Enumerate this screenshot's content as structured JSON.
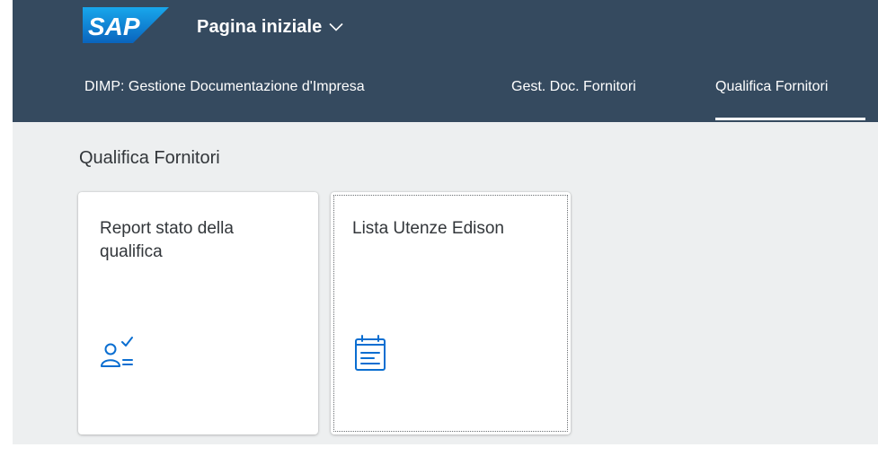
{
  "shell": {
    "logo_text": "SAP",
    "title": "Pagina iniziale",
    "title_menu_icon": "chevron-down-icon"
  },
  "tabs": [
    {
      "label": "DIMP: Gestione Documentazione d'Impresa",
      "active": false
    },
    {
      "label": "Gest. Doc. Fornitori",
      "active": false
    },
    {
      "label": "Qualifica Fornitori",
      "active": true
    }
  ],
  "section": {
    "title": "Qualifica Fornitori",
    "tiles": [
      {
        "title": "Report stato della qualifica",
        "icon": "user-check-list-icon"
      },
      {
        "title": "Lista Utenze Edison",
        "icon": "calendar-list-icon"
      }
    ]
  },
  "colors": {
    "shell_bg": "#354a5f",
    "page_bg": "#edeff0",
    "tile_icon": "#0a6ed1",
    "text": "#32363a",
    "logo_blue": "#0a73c8"
  }
}
